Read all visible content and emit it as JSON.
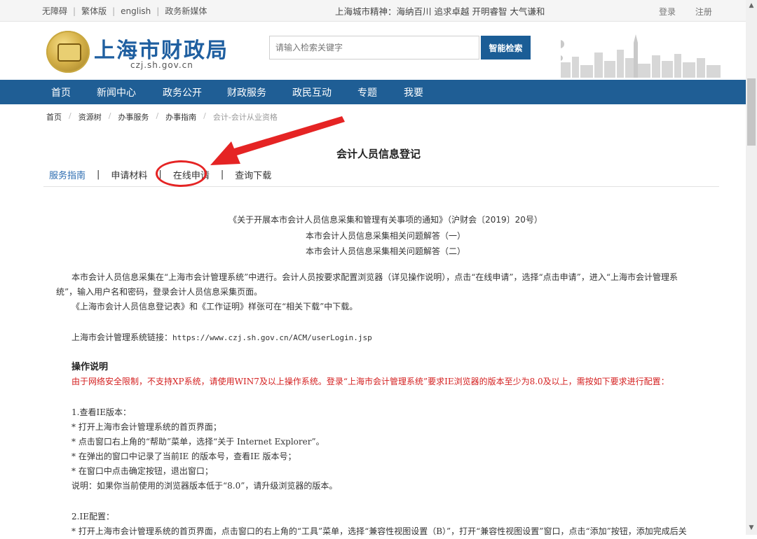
{
  "topbar": {
    "links": [
      "无障碍",
      "繁体版",
      "english",
      "政务新媒体"
    ],
    "slogan": "上海城市精神：海纳百川 追求卓越 开明睿智 大气谦和",
    "login": "登录",
    "register": "注册"
  },
  "header": {
    "title": "上海市财政局",
    "domain": "czj.sh.gov.cn",
    "search_placeholder": "请输入检索关键字",
    "search_button": "智能检索"
  },
  "nav": [
    "首页",
    "新闻中心",
    "政务公开",
    "财政服务",
    "政民互动",
    "专题",
    "我要"
  ],
  "breadcrumb": [
    "首页",
    "资源树",
    "办事服务",
    "办事指南",
    "会计-会计从业资格"
  ],
  "page": {
    "title": "会计人员信息登记",
    "tabs": [
      "服务指南",
      "申请材料",
      "在线申请",
      "查询下载"
    ]
  },
  "links": [
    "《关于开展本市会计人员信息采集和管理有关事项的通知》（沪财会〔2019〕20号）",
    "本市会计人员信息采集相关问题解答（一）",
    "本市会计人员信息采集相关问题解答（二）"
  ],
  "content": {
    "para1_line1": "本市会计人员信息采集在“上海市会计管理系统”中进行。会计人员按要求配置浏览器（详见操作说明），点击“在线申请”，选择“点击申请”，进入“上海市会计管理系",
    "para1_line2": "统”，输入用户名和密码，登录会计人员信息采集页面。",
    "para2": "《上海市会计人员信息登记表》和《工作证明》样张可在“相关下载”中下载。",
    "system_link_label": "上海市会计管理系统链接：",
    "system_link_url": "https://www.czj.sh.gov.cn/ACM/userLogin.jsp",
    "ops_title": "操作说明",
    "warning": "由于网络安全限制，不支持XP系统，请使用WIN7及以上操作系统。登录“上海市会计管理系统”要求IE浏览器的版本至少为8.0及以上，需按如下要求进行配置：",
    "step1_title": "1.查看IE版本：",
    "step1_items": [
      "* 打开上海市会计管理系统的首页界面；",
      "* 点击窗口右上角的“帮助”菜单，选择“关于 Internet Explorer”。",
      "* 在弹出的窗口中记录了当前IE 的版本号，查看IE 版本号；",
      "* 在窗口中点击确定按钮，退出窗口；"
    ],
    "step1_note": "说明：如果你当前使用的浏览器版本低于“8.0”，请升级浏览器的版本。",
    "step2_title": "2.IE配置：",
    "step2_item1": "* 打开上海市会计管理系统的首页界面，点击窗口的右上角的“工具”菜单，选择“兼容性视图设置（B）”，打开“兼容性视图设置”窗口，点击“添加”按钮，添加完成后关"
  },
  "colors": {
    "nav_bg": "#1f5e95",
    "accent_blue": "#2a6bb0",
    "warning_red": "#d42020",
    "annotation_red": "#e52424"
  }
}
